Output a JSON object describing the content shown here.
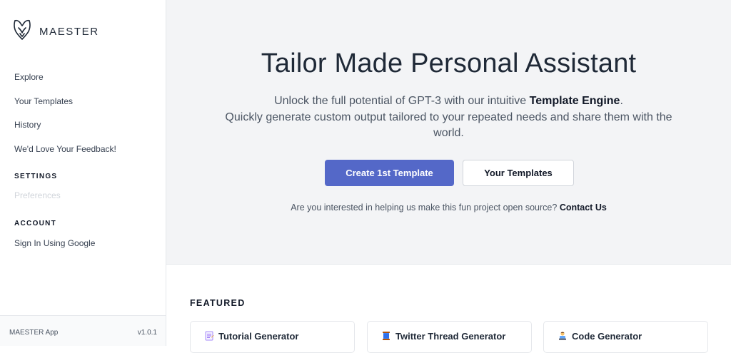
{
  "brand": {
    "name": "MAESTER"
  },
  "nav": {
    "items": [
      "Explore",
      "Your Templates",
      "History",
      "We'd Love Your Feedback!"
    ]
  },
  "settings": {
    "title": "SETTINGS",
    "preferences": "Preferences"
  },
  "account": {
    "title": "ACCOUNT",
    "sign_in": "Sign In Using Google"
  },
  "footer": {
    "app": "MAESTER App",
    "version": "v1.0.1"
  },
  "hero": {
    "title": "Tailor Made Personal Assistant",
    "sub_before": "Unlock the full potential of GPT-3 with our intuitive ",
    "sub_bold": "Template Engine",
    "sub_after": ".",
    "sub_line2": "Quickly generate custom output tailored to your repeated needs and share them with the world.",
    "primary_button": "Create 1st Template",
    "secondary_button": "Your Templates",
    "cta_text": "Are you interested in helping us make this fun project open source?",
    "cta_link": "Contact Us"
  },
  "featured": {
    "title": "FEATURED",
    "cards": [
      {
        "label": "Tutorial Generator",
        "icon": "memo-icon"
      },
      {
        "label": "Twitter Thread Generator",
        "icon": "spool-icon"
      },
      {
        "label": "Code Generator",
        "icon": "technologist-icon"
      }
    ]
  },
  "colors": {
    "primary": "#5468c8",
    "hero_bg": "#f3f4f6",
    "text_dark": "#1f2937"
  }
}
